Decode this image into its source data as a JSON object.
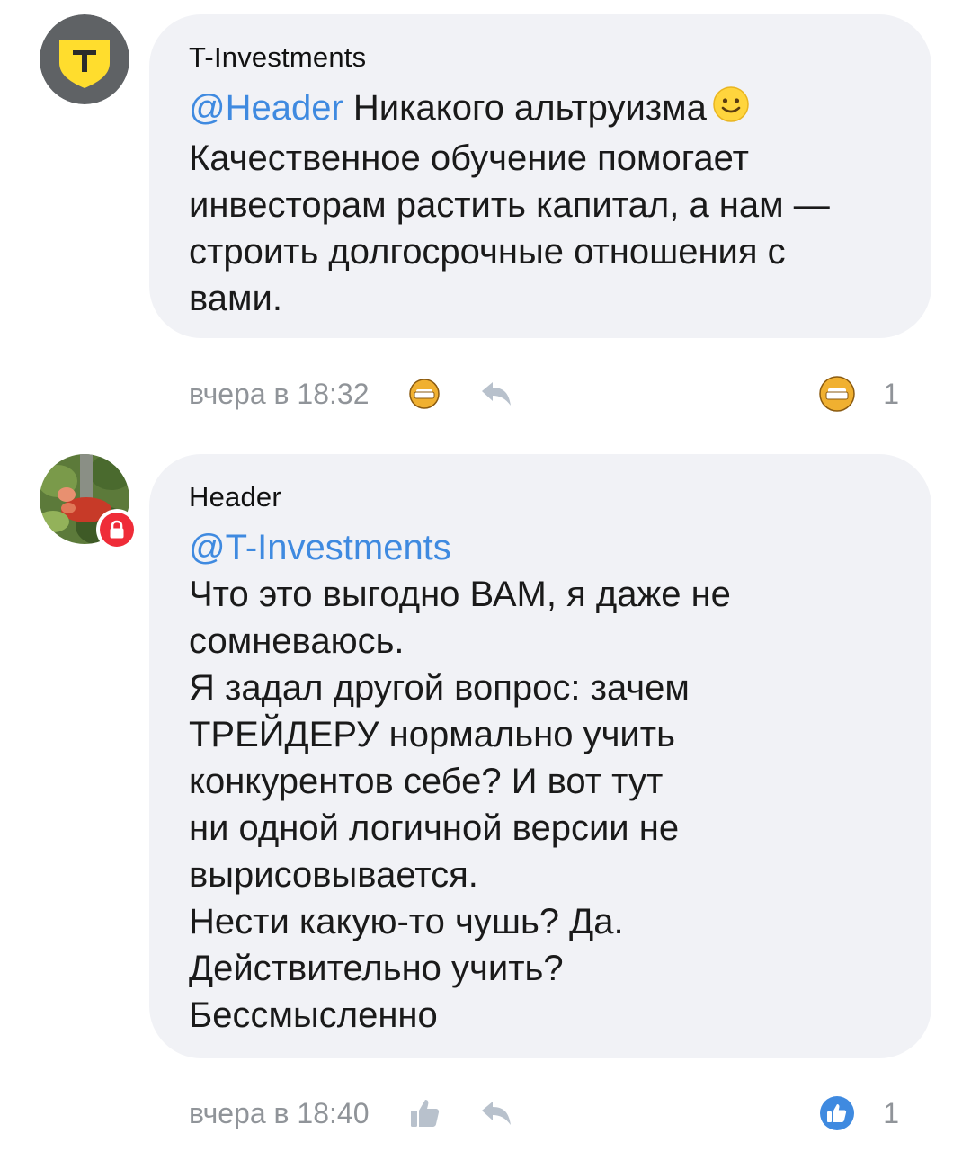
{
  "comments": [
    {
      "author": "T-Investments",
      "mention": "@Header",
      "lines": [
        " Никакого альтруизма",
        "Качественное обучение помогает",
        "инвесторам растить капитал, а нам —",
        "строить долгосрочные отношения с",
        "вами."
      ],
      "time": "вчера в 18:32",
      "reaction_count": "1",
      "reaction_icon": "sofa-icon",
      "emoji_icon": "slight-smile-emoji"
    },
    {
      "author": "Header",
      "mention": "@T-Investments",
      "lines": [
        "Что это выгодно ВАМ, я даже не",
        "сомневаюсь.",
        "Я задал другой вопрос: зачем",
        "ТРЕЙДЕРУ нормально учить",
        "конкурентов себе? И вот тут",
        "ни одной логичной версии не",
        "вырисовывается.",
        "Нести какую-то чушь? Да.",
        "Действительно учить?",
        "Бессмысленно"
      ],
      "time": "вчера в 18:40",
      "reaction_count": "1",
      "reaction_icon": "thumbs-up-icon"
    }
  ],
  "colors": {
    "mention": "#3f8ae0",
    "bubble": "#f1f2f6",
    "meta_text": "#909499",
    "brand_yellow": "#ffdd2d",
    "lock_red": "#ef2c38",
    "like_blue": "#3f8ae0"
  }
}
